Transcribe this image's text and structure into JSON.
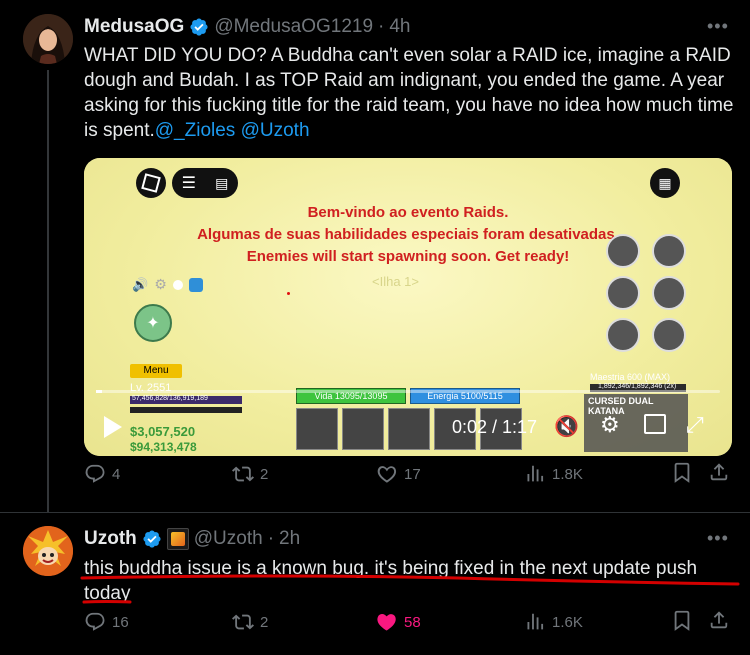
{
  "tweet1": {
    "name": "MedusaOG",
    "handle": "@MedusaOG1219",
    "time": "4h",
    "text": "WHAT DID YOU DO? A Buddha can't even solar a RAID ice, imagine a RAID dough and Budah. I as TOP Raid am indignant, you ended the game. A year asking for this fucking title for the raid team, you have no idea how much time is spent.",
    "mention1": "@_Zioles",
    "mention2": "@Uzoth",
    "replies": "4",
    "retweets": "2",
    "likes": "17",
    "views": "1.8K"
  },
  "video": {
    "overlay_line1": "Bem-vindo ao evento Raids.",
    "overlay_line2": "Algumas de suas habilidades especiais foram desativadas.",
    "overlay_line3": "Enemies will start spawning soon. Get ready!",
    "island_label": "<Ilha 1>",
    "menu_label": "Menu",
    "level_label": "Lv. 2551",
    "xp_label": "57,456,828/136,919,189",
    "money_label": "$3,057,520",
    "fragments_label": "$94,313,478",
    "hp_label": "Vida 13095/13095",
    "energy_label": "Energia 5100/5115",
    "mastery_label": "Maestria 600 (MAX)",
    "mastery_sub": "1,892,346/1,892,346 (2x)",
    "weapon_label": "CURSED DUAL KATANA",
    "time": "0:02 / 1:17"
  },
  "tweet2": {
    "name": "Uzoth",
    "handle": "@Uzoth",
    "time": "2h",
    "text_line1": "this buddha issue is a known bug. it's being fixed in the next update push",
    "text_line2": "today",
    "replies": "16",
    "retweets": "2",
    "likes": "58",
    "views": "1.6K"
  },
  "colors": {
    "accent": "#1d9bf0",
    "like": "#f91880",
    "annotation": "#d40000"
  }
}
